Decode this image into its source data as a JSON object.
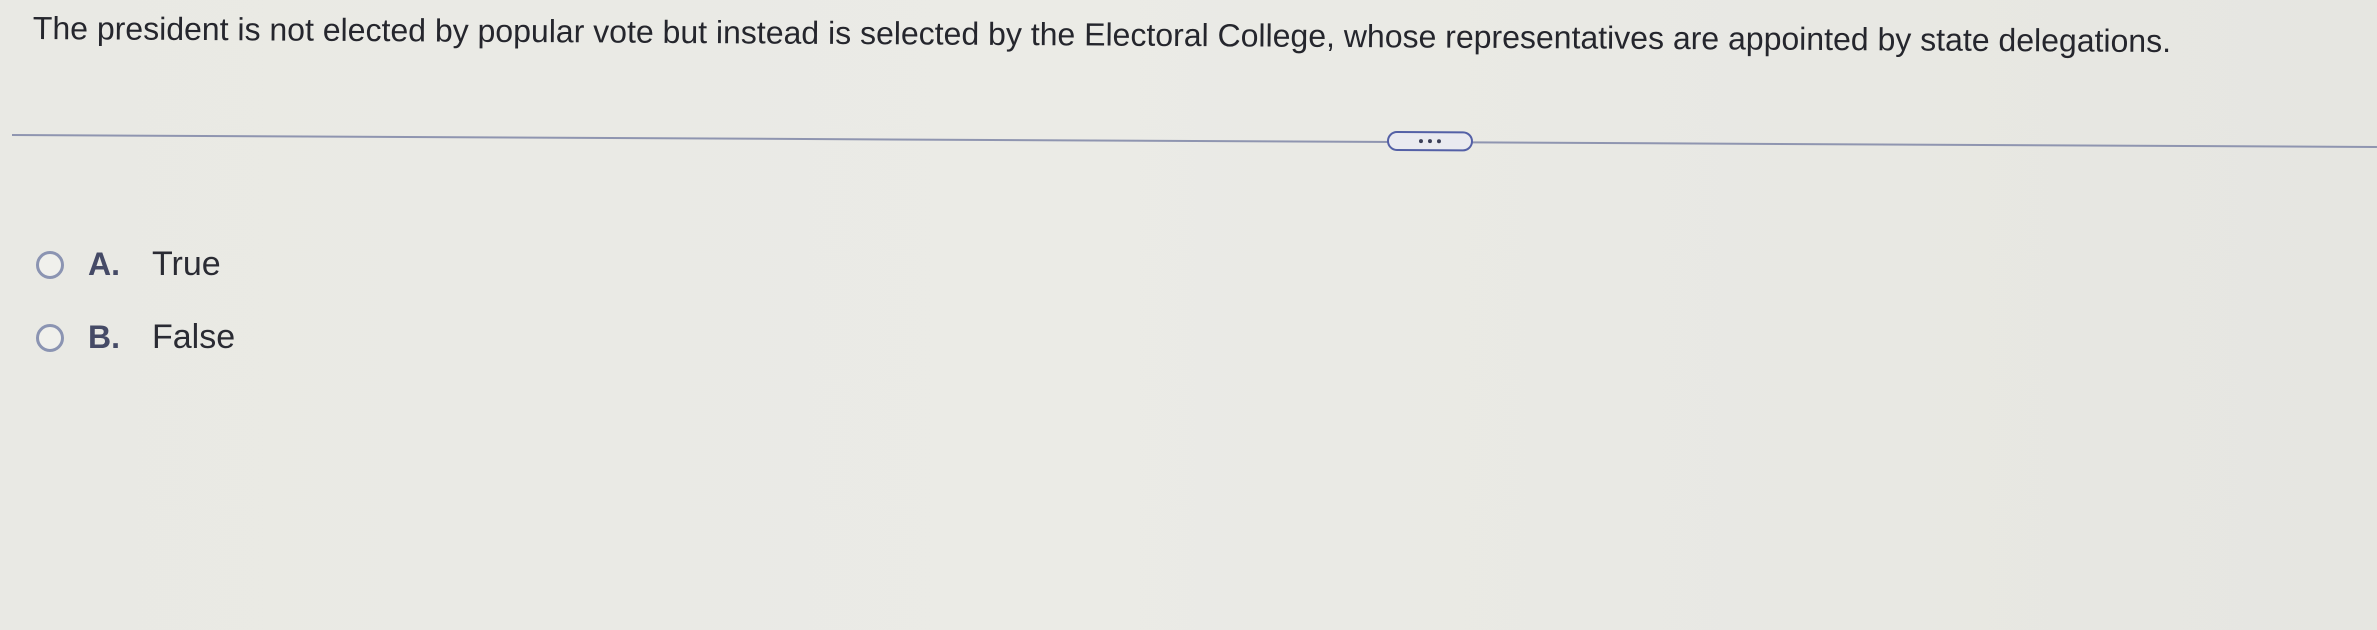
{
  "question": {
    "text": "The president is not elected by popular vote but instead is selected by the Electoral College, whose representatives are appointed by state delegations."
  },
  "divider": {
    "more_icon": "ellipsis-icon"
  },
  "options": [
    {
      "letter": "A.",
      "text": "True"
    },
    {
      "letter": "B.",
      "text": "False"
    }
  ],
  "colors": {
    "background": "#e9e9e4",
    "text": "#25262d",
    "accent": "#5460a6",
    "radio_border": "#8b94b2"
  }
}
